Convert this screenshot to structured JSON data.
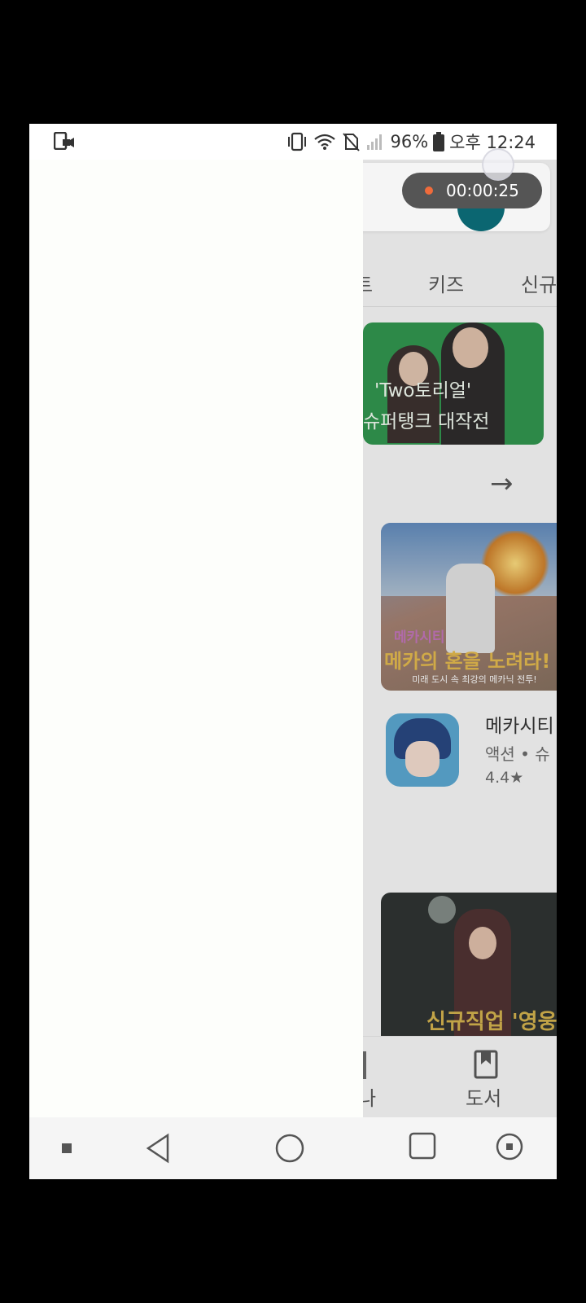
{
  "status_bar": {
    "battery_percent": "96%",
    "time": "오후 12:24",
    "icons": [
      "screen-record-icon",
      "vibrate-icon",
      "wifi-icon",
      "no-sim-icon",
      "signal-icon",
      "battery-icon"
    ]
  },
  "recorder": {
    "elapsed": "00:00:25"
  },
  "background_app": {
    "tabs": [
      "트",
      "키즈",
      "신규"
    ],
    "banner": {
      "line1": "'Two토리얼'",
      "line2": "슈퍼탱크 대작전"
    },
    "section_arrow": "→",
    "featured_game": {
      "logo": "메카시티",
      "headline": "메카의 혼을 노려라!",
      "tagline": "미래 도시 속 최강의 메카닉 전투!"
    },
    "app": {
      "title": "메카시티",
      "subtitle": "액션 • 슈",
      "rating": "4.4★"
    },
    "second_game_text": "신규직업 '영웅",
    "bottom_nav": {
      "partial_label": "나",
      "books_label": "도서"
    }
  },
  "nav_bar": {
    "buttons": [
      "back",
      "home",
      "recents",
      "accessibility"
    ]
  }
}
